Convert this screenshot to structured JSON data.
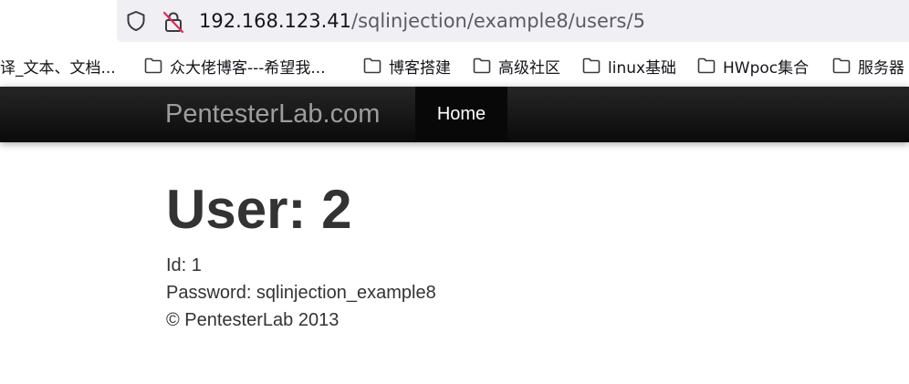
{
  "browser": {
    "url_host": "192.168.123.41",
    "url_path": "/sqlinjection/example8/users/5",
    "icons": [
      "shield-icon",
      "lock-slash-icon"
    ]
  },
  "bookmarks": [
    {
      "label": "译_文本、文档...",
      "has_folder": false
    },
    {
      "label": "众大佬博客---希望我...",
      "has_folder": true
    },
    {
      "label": "博客搭建",
      "has_folder": true
    },
    {
      "label": "高级社区",
      "has_folder": true
    },
    {
      "label": "linux基础",
      "has_folder": true
    },
    {
      "label": "HWpoc集合",
      "has_folder": true
    },
    {
      "label": "服务器",
      "has_folder": true
    }
  ],
  "navbar": {
    "brand": "PentesterLab.com",
    "home_label": "Home"
  },
  "main": {
    "title": "User: 2",
    "id_line": "Id: 1",
    "password_line": "Password: sqlinjection_example8",
    "footer": "© PentesterLab 2013"
  },
  "colors": {
    "navbar_top": "#262626",
    "navbar_bottom": "#0a0a0a",
    "brand_text": "#9d9d9d",
    "body_text": "#333333",
    "address_bar_bg": "#f0f0f4"
  }
}
